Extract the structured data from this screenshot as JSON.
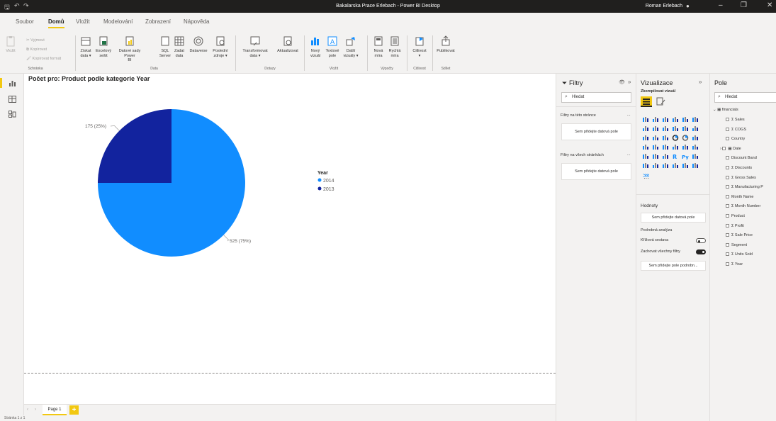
{
  "titlebar": {
    "title": "Bakalarska Prace Erlebach - Power BI Desktop",
    "user": "Roman Erlebach"
  },
  "menu_tabs": [
    "Soubor",
    "Domů",
    "Vložit",
    "Modelování",
    "Zobrazení",
    "Nápověda"
  ],
  "ribbon": {
    "clipboard": {
      "paste": "Vložit",
      "cut": "Vyjmout",
      "copy": "Kopírovat",
      "format": "Kopírovat formát",
      "group": "Schránka"
    },
    "data": {
      "get_data": [
        "Získat",
        "data ▾"
      ],
      "excel": [
        "Excelový",
        "sešit"
      ],
      "datasets": [
        "Datové sady Power",
        "BI"
      ],
      "sql": [
        "SQL",
        "Server"
      ],
      "enter": [
        "Zadat",
        "data"
      ],
      "dataverse": [
        "Dataverse",
        ""
      ],
      "recent": [
        "Poslední",
        "zdroje ▾"
      ],
      "group": "Data"
    },
    "queries": {
      "transform": [
        "Transformovat",
        "data ▾"
      ],
      "refresh": [
        "Aktualizovat",
        ""
      ],
      "group": "Dotazy"
    },
    "insert": {
      "new_visual": [
        "Nový",
        "vizuál"
      ],
      "text": [
        "Textové",
        "pole"
      ],
      "more": [
        "Další",
        "vizuály ▾"
      ],
      "group": "Vložit"
    },
    "calc": {
      "measure": [
        "Nová",
        "míra"
      ],
      "quick": [
        "Rychlá",
        "míra"
      ],
      "group": "Výpočty"
    },
    "sensitivity": {
      "label": [
        "Citlivost",
        "▾"
      ],
      "group": "Citlivost"
    },
    "share": {
      "publish": [
        "Publikovat",
        ""
      ],
      "group": "Sdílet"
    }
  },
  "visual": {
    "title": "Počet pro: Product podle kategorie Year",
    "legend_title": "Year",
    "legend": [
      {
        "label": "2014",
        "color": "#118dff"
      },
      {
        "label": "2013",
        "color": "#12239e"
      }
    ],
    "label_2013": "175 (25%)",
    "label_2014": "525 (75%)"
  },
  "chart_data": {
    "type": "pie",
    "title": "Počet pro: Product podle kategorie Year",
    "categories": [
      "2014",
      "2013"
    ],
    "values": [
      525,
      175
    ],
    "percent": [
      75,
      25
    ],
    "colors": [
      "#118dff",
      "#12239e"
    ],
    "legend_title": "Year",
    "legend_position": "right"
  },
  "pages": {
    "tab": "Page 1",
    "add": "+"
  },
  "status": "Stránka 1 z 1",
  "filters": {
    "title": "Filtry",
    "search": "Hledat",
    "page_label": "Filtry na této stránce",
    "page_drop": "Sem přidejte datová pole",
    "all_label": "Filtry na všech stránkách",
    "all_drop": "Sem přidejte datová pole",
    "more": "..."
  },
  "viz": {
    "title": "Vizualizace",
    "build": "Zkompilovat vizuál",
    "values_label": "Hodnoty",
    "values_drop": "Sem přidejte datová pole",
    "drill_label": "Podrobná analýza",
    "cross_report": "Křížová sestava",
    "keep_filters": "Zachovat všechny filtry",
    "drill_drop": "Sem přidejte pole podrobn...",
    "more": "···"
  },
  "fields": {
    "title": "Pole",
    "search": "Hledat",
    "table": "financials",
    "items": [
      "Σ Sales",
      "Σ COGS",
      "Country",
      "Date",
      "Discount Band",
      "Σ Discounts",
      "Σ Gross Sales",
      "Σ Manufacturing P",
      "Month Name",
      "Σ Month Number",
      "Product",
      "Σ Profit",
      "Σ Sale Price",
      "Segment",
      "Σ Units Sold",
      "Σ Year"
    ]
  },
  "colors": {
    "accent": "#f2c811",
    "pie_2014": "#118dff",
    "pie_2013": "#12239e"
  }
}
